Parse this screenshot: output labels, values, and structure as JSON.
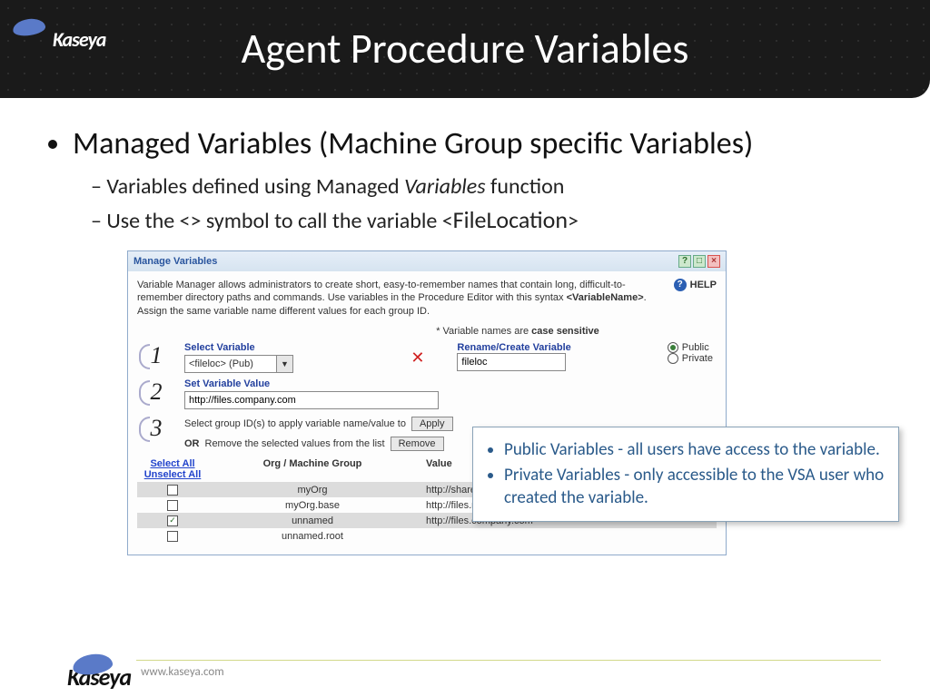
{
  "header": {
    "logo": "Kaseya",
    "title": "Agent Procedure Variables"
  },
  "bullets": {
    "main": "Managed Variables (Machine Group specific Variables)",
    "sub1_a": "Variables defined using Managed ",
    "sub1_b": "Variables",
    "sub1_c": " function",
    "sub2_a": "Use the <> symbol to call the variable <",
    "sub2_b": "FileLocation",
    "sub2_c": ">"
  },
  "dialog": {
    "title": "Manage Variables",
    "help_text_a": "Variable Manager allows administrators to create short, easy-to-remember names that contain long, difficult-to-remember directory paths and commands. Use variables in the Procedure Editor with this syntax ",
    "help_text_b": "<VariableName>",
    "help_text_c": ". Assign the same variable name different values for each group ID.",
    "help_label": "HELP",
    "case_note_a": "* Variable names are ",
    "case_note_b": "case sensitive",
    "step1_label": "Select Variable",
    "step1_value": "<fileloc> (Pub)",
    "step1_rename_label": "Rename/Create Variable",
    "step1_rename_value": "fileloc",
    "radio_public": "Public",
    "radio_private": "Private",
    "step2_label": "Set Variable Value",
    "step2_value": "http://files.company.com",
    "step3_line1": "Select group ID(s) to apply variable name/value to",
    "apply_btn": "Apply",
    "step3_or": "OR",
    "step3_line2": " Remove the selected values from the list",
    "remove_btn": "Remove",
    "select_all": "Select All",
    "unselect_all": "Unselect All",
    "th_org": "Org / Machine Group",
    "th_val": "Value",
    "rows": [
      {
        "checked": false,
        "org": "myOrg",
        "val": "http://shares.myorg.com"
      },
      {
        "checked": false,
        "org": "myOrg.base",
        "val": "http://files.myorg.com"
      },
      {
        "checked": true,
        "org": "unnamed",
        "val": "http://files.company.com"
      },
      {
        "checked": false,
        "org": "unnamed.root",
        "val": ""
      }
    ],
    "num1": "1",
    "num2": "2",
    "num3": "3"
  },
  "callout": {
    "item1": "Public Variables - all users have access to the variable.",
    "item2": "Private Variables - only accessible to the VSA user who created the variable."
  },
  "footer": {
    "logo": "Kaseya",
    "url": "www.kaseya.com"
  }
}
